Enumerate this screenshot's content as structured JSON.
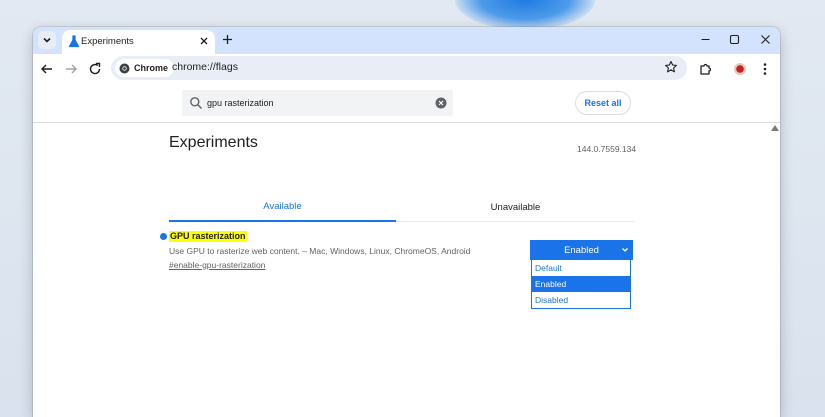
{
  "browser": {
    "tab": {
      "title": "Experiments"
    },
    "omnibox": {
      "chip_label": "Chrome",
      "url": "chrome://flags"
    }
  },
  "page": {
    "search": {
      "value": "gpu rasterization"
    },
    "reset_label": "Reset all",
    "title": "Experiments",
    "version": "144.0.7559.134",
    "tabs": [
      {
        "label": "Available",
        "active": true
      },
      {
        "label": "Unavailable",
        "active": false
      }
    ],
    "flag": {
      "name": "GPU rasterization",
      "description": "Use GPU to rasterize web content. – Mac, Windows, Linux, ChromeOS, Android",
      "link": "#enable-gpu-rasterization",
      "select_value": "Enabled",
      "options": [
        "Default",
        "Enabled",
        "Disabled"
      ],
      "selected_option": "Enabled"
    }
  },
  "colors": {
    "accent": "#1a73e8",
    "titlebar": "#d3e3fd",
    "highlight": "#ffff00"
  },
  "icons": [
    "chevron-down-icon",
    "experiments-icon",
    "close-icon",
    "plus-icon",
    "minimize-icon",
    "maximize-icon",
    "back-icon",
    "forward-icon",
    "reload-icon",
    "chrome-icon",
    "star-icon",
    "extensions-icon",
    "profile-icon",
    "menu-icon",
    "search-icon",
    "clear-icon"
  ]
}
